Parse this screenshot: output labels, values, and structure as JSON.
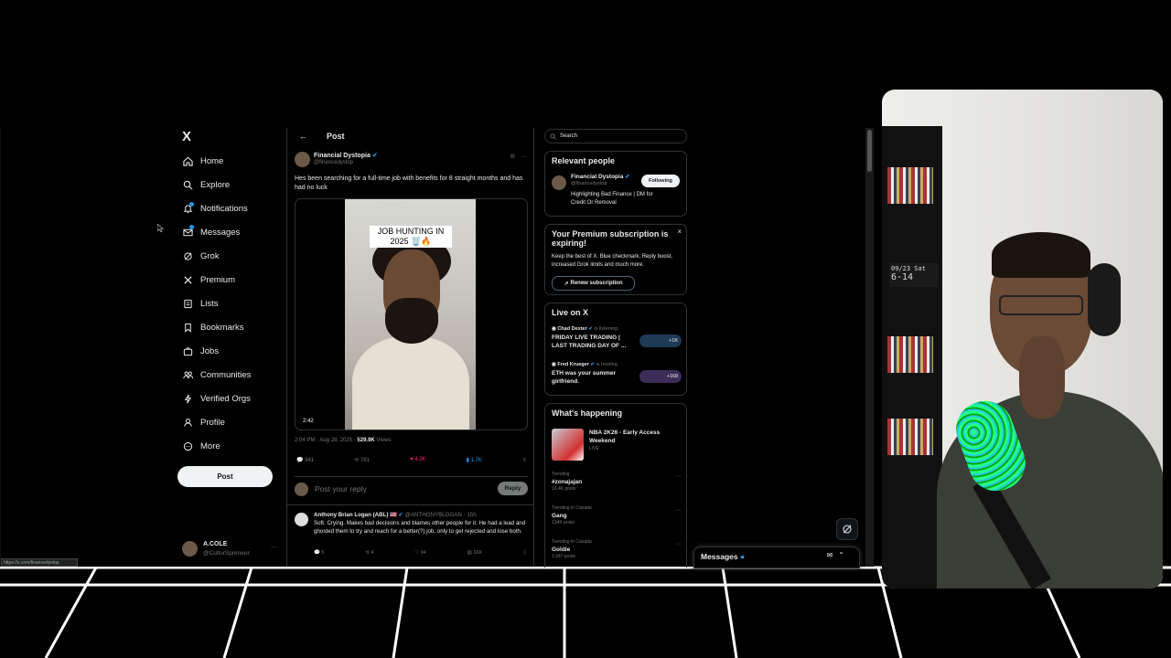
{
  "sidebar": {
    "logo": "X",
    "items": [
      {
        "label": "Home",
        "icon": "home-icon"
      },
      {
        "label": "Explore",
        "icon": "search-icon"
      },
      {
        "label": "Notifications",
        "icon": "bell-icon"
      },
      {
        "label": "Messages",
        "icon": "envelope-icon"
      },
      {
        "label": "Grok",
        "icon": "grok-icon"
      },
      {
        "label": "Premium",
        "icon": "x-logo-icon"
      },
      {
        "label": "Lists",
        "icon": "list-icon"
      },
      {
        "label": "Bookmarks",
        "icon": "bookmark-icon"
      },
      {
        "label": "Jobs",
        "icon": "briefcase-icon"
      },
      {
        "label": "Communities",
        "icon": "people-icon"
      },
      {
        "label": "Verified Orgs",
        "icon": "lightning-icon"
      },
      {
        "label": "Profile",
        "icon": "person-icon"
      },
      {
        "label": "More",
        "icon": "more-circle-icon"
      }
    ],
    "post_button": "Post",
    "account": {
      "name": "A.COLE",
      "handle": "@CulturSpreneur",
      "more": "···"
    }
  },
  "status_url": "https://x.com/financedystop",
  "post": {
    "header": "Post",
    "back": "←",
    "author_name": "Financial Dystopia",
    "author_handle": "@financedystop",
    "more": "···",
    "text": "Hes been searching for a full-time job with benefits for 8 straight months and has had no luck",
    "video_caption": "JOB HUNTING IN 2025 🗑️🔥",
    "video_duration": "2:42",
    "timestamp": "2:04 PM · Aug 28, 2025 · ",
    "views_count": "529.9K",
    "views_label": " Views",
    "stats": {
      "replies": "941",
      "reposts": "761",
      "likes": "4.3K",
      "bookmarks": "1.7K"
    },
    "reply_placeholder": "Post your reply",
    "reply_button": "Reply"
  },
  "reply": {
    "name": "Anthony Brian Logan (ABL) 🇺🇸",
    "handle_time": "@ANTHONYBLOGAN · 15h",
    "text": "Soft. Crying. Makes bad decisions and blames other people for it. He had a lead and ghosted them to try and reach for a better(?) job, only to get rejected and lose both.",
    "stats": {
      "replies": "5",
      "reposts": "4",
      "likes": "94",
      "views": "16K"
    }
  },
  "right": {
    "search_placeholder": "Search",
    "relevant": {
      "title": "Relevant people",
      "name": "Financial Dystopia",
      "handle": "@financedystop",
      "bio": "Highlighting Bad Finance | DM for Credit Or Removal",
      "button": "Following"
    },
    "premium": {
      "title": "Your Premium subscription is expiring!",
      "close": "×",
      "text": "Keep the best of X. Blue checkmark, Reply boost, increased Grok limits and much more.",
      "button": "Renew subscription"
    },
    "live": {
      "title": "Live on X",
      "items": [
        {
          "host": "Chad Dexter",
          "status": "is listening",
          "title": "FRIDAY LIVE TRADING | LAST TRADING DAY OF ...",
          "count": "+1K"
        },
        {
          "host": "Fred Krueger",
          "status": "is hosting",
          "title": "ETH was your summer girlfriend.",
          "count": "+168"
        }
      ]
    },
    "happening": {
      "title": "What's happening",
      "event": {
        "name": "NBA 2K26 - Early Access Weekend",
        "status": "LIVE"
      },
      "trends": [
        {
          "context": "Trending",
          "name": "#zonajajan",
          "count": "16.4K posts"
        },
        {
          "context": "Trending in Canada",
          "name": "Gang",
          "count": "134K posts"
        },
        {
          "context": "Trending in Canada",
          "name": "Goldie",
          "count": "1,947 posts"
        }
      ],
      "more": "···"
    }
  },
  "messages_bar": {
    "title": "Messages"
  },
  "webcam": {
    "clock_line1": "09/23 Sat",
    "clock_line2": "6-14"
  }
}
